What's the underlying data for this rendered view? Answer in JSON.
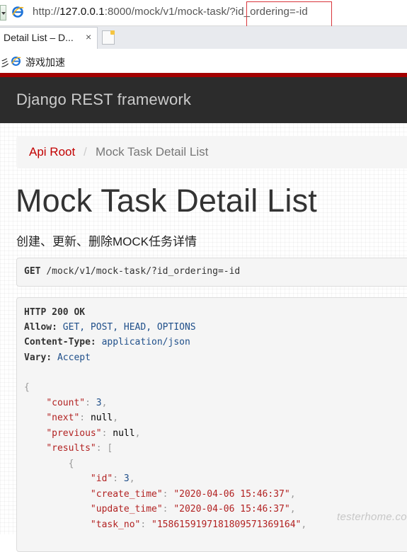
{
  "browser": {
    "url_prefix": "http://",
    "url_host": "127.0.0.1",
    "url_path": ":8000/mock/v1/mock-task/",
    "url_query": "?id_ordering=-id",
    "tab_title": "Detail List – D...",
    "tab_close": "×",
    "favorites_partial": "彡",
    "favorites_item": "游戏加速"
  },
  "navbar": {
    "brand": "Django REST framework"
  },
  "breadcrumb": {
    "root": "Api Root",
    "separator": "/",
    "active": "Mock Task Detail List"
  },
  "page": {
    "title": "Mock Task Detail List",
    "description": "创建、更新、删除MOCK任务详情"
  },
  "request": {
    "method": "GET",
    "path": "/mock/v1/mock-task/?id_ordering=-id"
  },
  "response": {
    "status": "HTTP 200 OK",
    "headers": [
      {
        "name": "Allow:",
        "value": "GET, POST, HEAD, OPTIONS"
      },
      {
        "name": "Content-Type:",
        "value": "application/json"
      },
      {
        "name": "Vary:",
        "value": "Accept"
      }
    ],
    "body": {
      "open_brace": "{",
      "count_key": "\"count\"",
      "count_value": "3",
      "next_key": "\"next\"",
      "next_value": "null",
      "previous_key": "\"previous\"",
      "previous_value": "null",
      "results_key": "\"results\"",
      "results_open": "[",
      "item_open": "{",
      "id_key": "\"id\"",
      "id_value": "3",
      "create_time_key": "\"create_time\"",
      "create_time_value": "\"2020-04-06 15:46:37\"",
      "update_time_key": "\"update_time\"",
      "update_time_value": "\"2020-04-06 15:46:37\"",
      "task_no_key": "\"task_no\"",
      "task_no_value": "\"15861591971818095713691​64\""
    }
  },
  "watermark": "testerhome.com",
  "colors": {
    "accent_red": "#a30000",
    "link_red": "#c20000",
    "navbar": "#2c2c2c"
  }
}
